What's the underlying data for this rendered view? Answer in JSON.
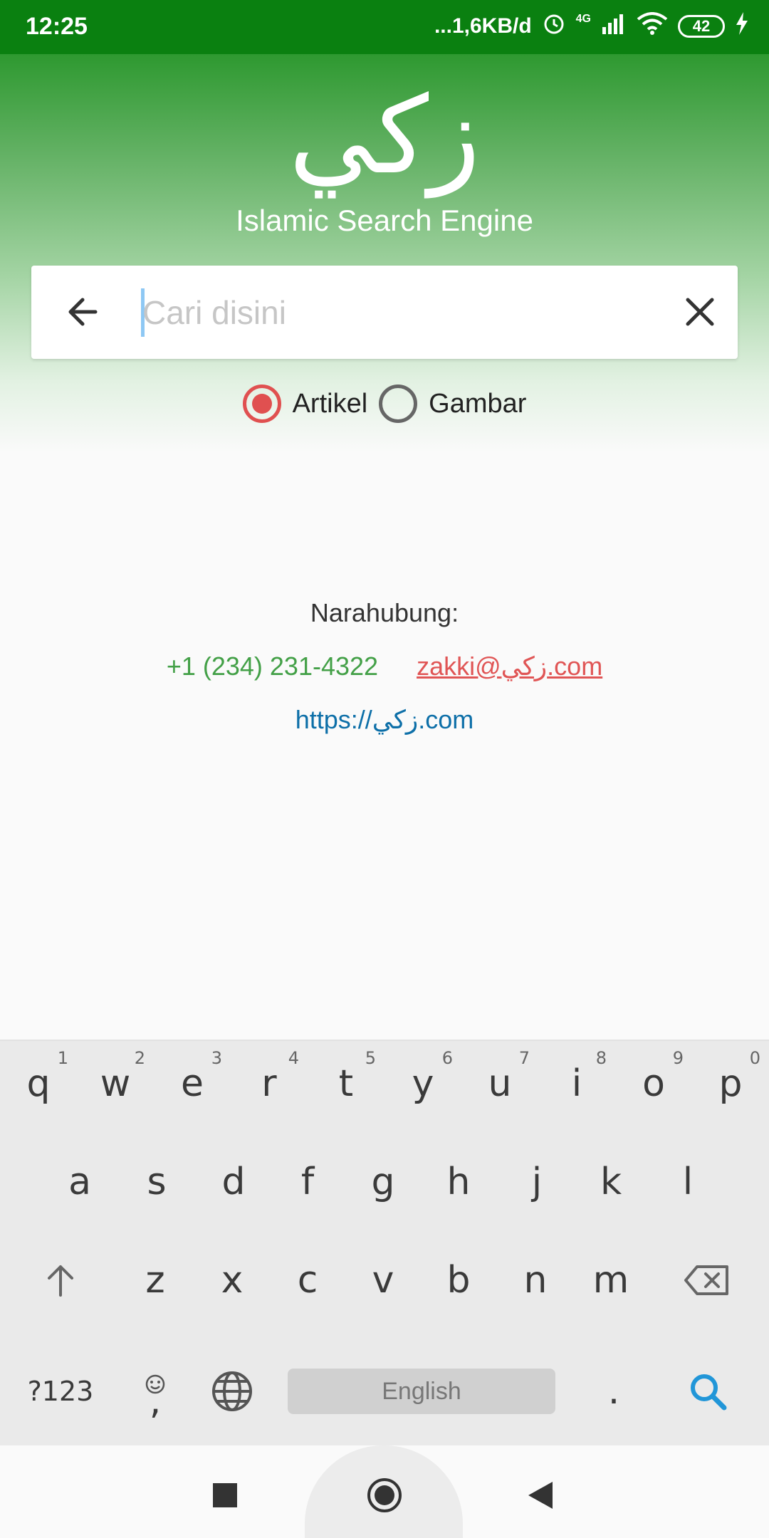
{
  "status_bar": {
    "time": "12:25",
    "network_speed": "...1,6KB/d",
    "network_type": "4G",
    "battery": "42",
    "icons": [
      "alarm-icon",
      "signal-icon",
      "wifi-icon",
      "battery-icon",
      "charging-icon"
    ]
  },
  "app": {
    "logo_text": "زكي",
    "subtitle": "Islamic Search Engine"
  },
  "search": {
    "placeholder": "Cari disini",
    "value": "",
    "back_icon": "arrow-left-icon",
    "clear_icon": "close-icon"
  },
  "filters": {
    "options": [
      {
        "label": "Artikel",
        "selected": true
      },
      {
        "label": "Gambar",
        "selected": false
      }
    ]
  },
  "contact": {
    "title": "Narahubung:",
    "phone": "+1 (234) 231-4322",
    "email": "zakki@زكي.com",
    "website": "https://زكي.com"
  },
  "keyboard": {
    "row1": [
      {
        "key": "q",
        "hint": "1"
      },
      {
        "key": "w",
        "hint": "2"
      },
      {
        "key": "e",
        "hint": "3"
      },
      {
        "key": "r",
        "hint": "4"
      },
      {
        "key": "t",
        "hint": "5"
      },
      {
        "key": "y",
        "hint": "6"
      },
      {
        "key": "u",
        "hint": "7"
      },
      {
        "key": "i",
        "hint": "8"
      },
      {
        "key": "o",
        "hint": "9"
      },
      {
        "key": "p",
        "hint": "0"
      }
    ],
    "row2": [
      "a",
      "s",
      "d",
      "f",
      "g",
      "h",
      "j",
      "k",
      "l"
    ],
    "row3": [
      "z",
      "x",
      "c",
      "v",
      "b",
      "n",
      "m"
    ],
    "symbols_key": "?123",
    "comma_key": ",",
    "space_label": "English",
    "period_key": ".",
    "accent_color": "#2196d8"
  },
  "colors": {
    "status_bar": "#0a8010",
    "radio_selected": "#e05050",
    "phone": "#43a047",
    "email": "#e05555",
    "website": "#0d6fa8"
  }
}
